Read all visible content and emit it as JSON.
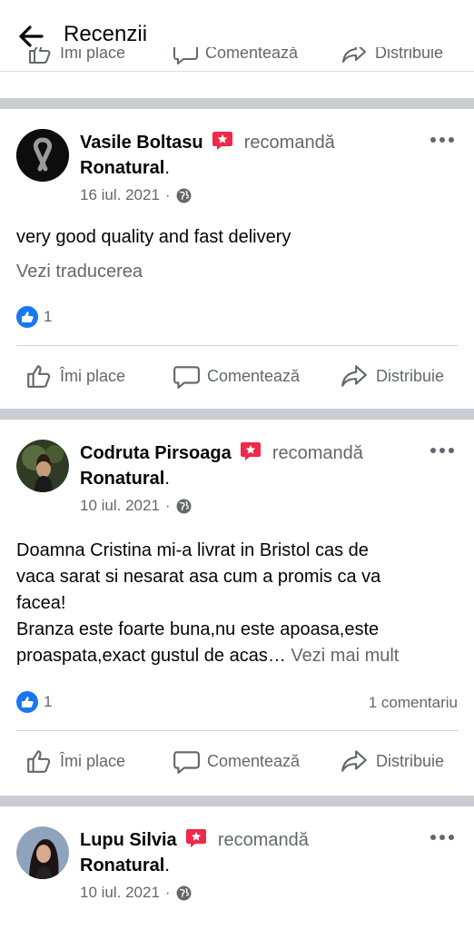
{
  "header": {
    "title": "Recenzii"
  },
  "actions": {
    "like": "Îmi place",
    "comment": "Comentează",
    "share": "Distribuie"
  },
  "posts": [
    {
      "author": "Vasile Boltasu",
      "recommends": "recomandă",
      "page": "Ronatural",
      "date": "16 iul. 2021",
      "dot": "·",
      "text": "very good quality and fast delivery",
      "translate": "Vezi traducerea",
      "reactions": "1",
      "avatar_color": "#111111"
    },
    {
      "author": "Codruta Pirsoaga",
      "recommends": "recomandă",
      "page": "Ronatural",
      "date": "10 iul. 2021",
      "dot": "·",
      "text_lines": [
        "Doamna Cristina mi-a livrat in Bristol cas de",
        "vaca sarat si nesarat asa cum a promis ca va",
        "facea!",
        "Branza este foarte buna,nu este apoasa,este",
        "proaspata,exact gustul de acas…"
      ],
      "see_more": "Vezi mai mult",
      "reactions": "1",
      "comments": "1 comentariu",
      "avatar_color": "#3a4a2e"
    },
    {
      "author": "Lupu Silvia",
      "recommends": "recomandă",
      "page": "Ronatural",
      "date": "10 iul. 2021",
      "dot": "·",
      "avatar_color": "#7a8aa0"
    }
  ],
  "colors": {
    "separator": "#c9ccd1",
    "like_blue": "#1877f2",
    "recommend_red": "#f02849",
    "secondary_text": "#65676b"
  }
}
